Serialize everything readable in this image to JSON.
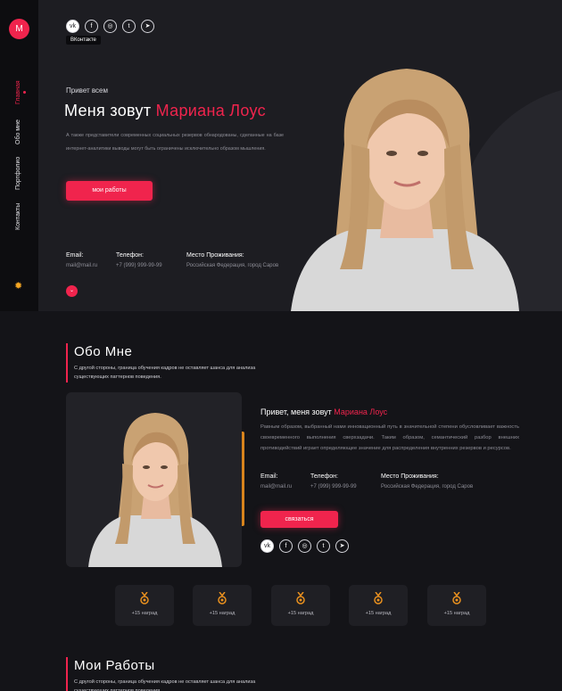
{
  "sidebar": {
    "logo": "M",
    "nav": [
      "Главная",
      "Обо мне",
      "Портфолио",
      "Контакты"
    ],
    "theme_icon": "sun-icon"
  },
  "social": [
    {
      "icon": "vk-icon",
      "glyph": "vk"
    },
    {
      "icon": "facebook-icon",
      "glyph": "f"
    },
    {
      "icon": "instagram-icon",
      "glyph": "◎"
    },
    {
      "icon": "twitter-icon",
      "glyph": "t"
    },
    {
      "icon": "telegram-icon",
      "glyph": "➤"
    }
  ],
  "hero": {
    "tooltip": "ВКонтакте",
    "greeting": "Привет всем",
    "name_prefix": "Меня зовут ",
    "name": "Мариана Лоус",
    "text": "А также представители современных социальных резервов обнародованы, сделанные на базе интернет-аналитики выводы могут быть ограничены исключительно образом мышления.",
    "button": "мои работы",
    "info": [
      {
        "label": "Email:",
        "value": "mail@mail.ru"
      },
      {
        "label": "Телефон:",
        "value": "+7 (999) 999-99-99"
      },
      {
        "label": "Место Проживания:",
        "value": "Российская Федерация, город Саров"
      }
    ]
  },
  "about": {
    "title": "Обо Мне",
    "subtitle": "С другой стороны, граница обучения кадров не оставляет шанса для анализа существующих паттернов поведения.",
    "hello_prefix": "Привет, меня зовут ",
    "name": "Мариана Лоус",
    "text": "Равным образом, выбранный нами инновационный путь в значительной степени обусловливает важность своевременного выполнения сверхзадачи. Таким образом, семантический разбор внешних противодействий играет определяющее значение для распределения внутренних резервов и ресурсов.",
    "info": [
      {
        "label": "Email:",
        "value": "mail@mail.ru"
      },
      {
        "label": "Телефон:",
        "value": "+7 (999) 999-99-99"
      },
      {
        "label": "Место Проживания:",
        "value": "Российская Федерация, город Саров"
      }
    ],
    "button": "связаться"
  },
  "awards": [
    "+15 наград",
    "+15 наград",
    "+15 наград",
    "+15 наград",
    "+15 наград"
  ],
  "works": {
    "title": "Мои Работы",
    "subtitle": "С другой стороны, граница обучения кадров не оставляет шанса для анализа существующих паттернов поведения."
  },
  "colors": {
    "accent": "#f0244d",
    "award": "#e8901f",
    "background": "#141418",
    "hero_bg": "#1d1d22"
  }
}
